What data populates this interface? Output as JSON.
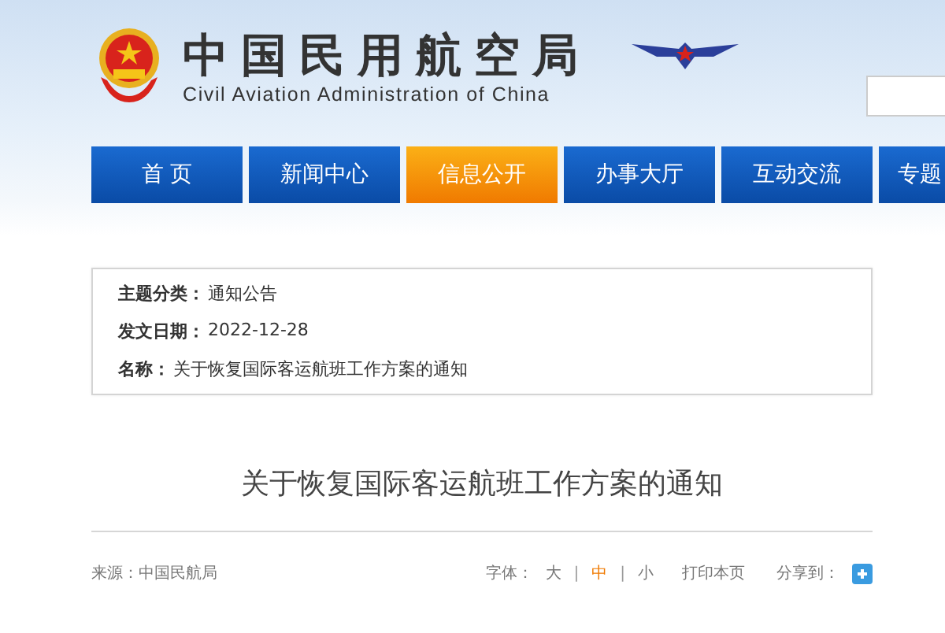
{
  "header": {
    "title": "中国民用航空局",
    "subtitle": "Civil Aviation Administration of China"
  },
  "nav": [
    {
      "label": "首 页",
      "selected": false
    },
    {
      "label": "新闻中心",
      "selected": false
    },
    {
      "label": "信息公开",
      "selected": true
    },
    {
      "label": "办事大厅",
      "selected": false
    },
    {
      "label": "互动交流",
      "selected": false
    },
    {
      "label": "专题",
      "selected": false
    }
  ],
  "info": [
    {
      "label": "主题分类：",
      "value": "通知公告"
    },
    {
      "label": "发文日期：",
      "value": "2022-12-28"
    },
    {
      "label": "名称：",
      "value": "关于恢复国际客运航班工作方案的通知"
    }
  ],
  "article": {
    "title": "关于恢复国际客运航班工作方案的通知"
  },
  "footer": {
    "source": "来源：中国民航局",
    "font_label": "字体：",
    "font_sizes": [
      {
        "label": "大",
        "selected": false
      },
      {
        "label": "中",
        "selected": true
      },
      {
        "label": "小",
        "selected": false
      }
    ],
    "separators": [
      "|",
      "|"
    ],
    "print": "打印本页",
    "share": "分享到："
  }
}
